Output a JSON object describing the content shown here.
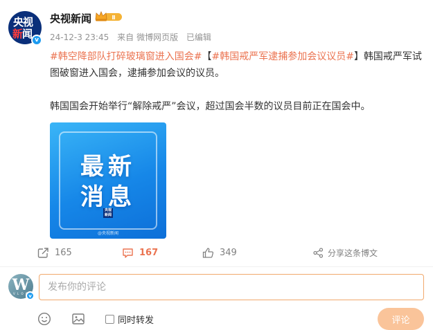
{
  "post": {
    "avatar_text_1": "央视",
    "avatar_text_2a": "新",
    "avatar_text_2b": "闻",
    "verified_mark": "v",
    "username": "央视新闻",
    "member_badge": "Ⅱ",
    "timestamp": "24-12-3 23:45",
    "source_prefix": "来自",
    "source": "微博网页版",
    "edited": "已编辑",
    "content": {
      "hashtag1": "#韩空降部队打碎玻璃窗进入国会#",
      "bracket_open": "【",
      "hashtag2": "#韩国戒严军逮捕参加会议议员#",
      "bracket_close": "】",
      "text1": "韩国戒严军试图破窗进入国会，逮捕参加会议的议员。",
      "text2": "韩国国会开始举行“解除戒严”会议，超过国会半数的议员目前正在国会中。"
    },
    "image": {
      "line1": "最新",
      "line2": "消息",
      "mini_logo": "央视新闻",
      "watermark": "@央视新闻"
    }
  },
  "actions": {
    "repost_count": "165",
    "comment_count": "167",
    "like_count": "349",
    "share_label": "分享这条博文"
  },
  "composer": {
    "avatar_letter": "W",
    "avatar_sub": "V L O G",
    "placeholder": "发布你的评论",
    "repost_label": "同时转发",
    "submit_label": "评论"
  },
  "icons": {
    "repost": "repost-icon",
    "comment": "comment-icon",
    "like": "like-icon",
    "share": "share-icon",
    "emoji": "emoji-icon",
    "image": "image-icon",
    "crown": "crown-icon"
  },
  "colors": {
    "accent": "#eb7350",
    "verified": "#1d9bf0",
    "submit_bg": "#fac49a",
    "input_border": "#f1a86b"
  }
}
